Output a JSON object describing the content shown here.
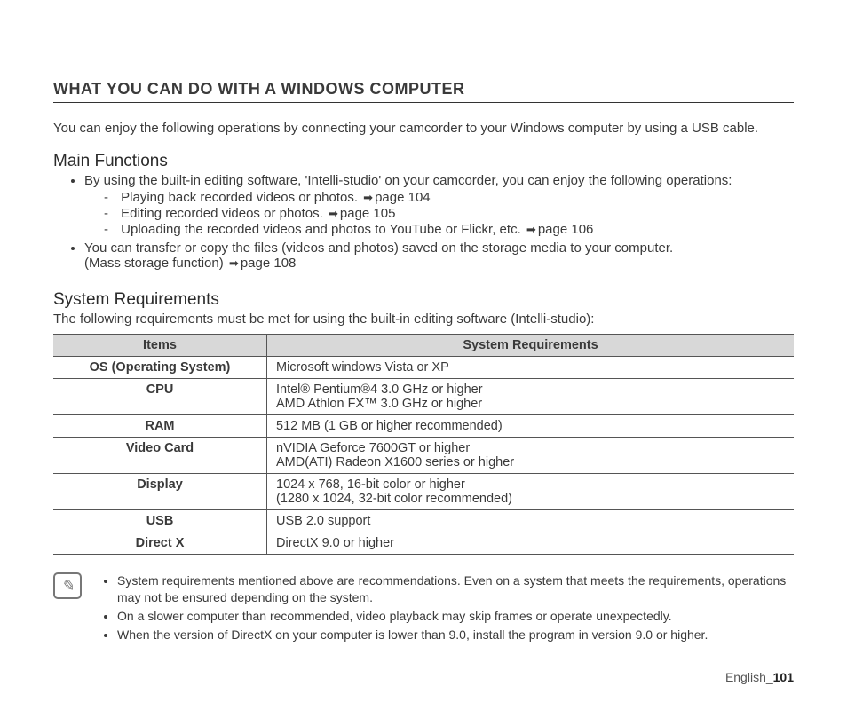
{
  "title": "WHAT YOU CAN DO WITH A WINDOWS COMPUTER",
  "intro": "You can enjoy the following operations by connecting your camcorder to your Windows computer by using a USB cable.",
  "main": {
    "heading": "Main Functions",
    "item1": "By using the built-in editing software, 'Intelli-studio' on your camcorder, you can enjoy the following operations:",
    "sub1_t": "Playing back recorded videos or photos. ",
    "sub1_p": "page 104",
    "sub2_t": "Editing recorded videos or photos. ",
    "sub2_p": "page 105",
    "sub3_t": "Uploading the recorded videos and photos to YouTube or Flickr, etc. ",
    "sub3_p": "page 106",
    "item2_a": "You can transfer or copy the files (videos and photos) saved on the storage media to your computer.",
    "item2_b": "(Mass storage function) ",
    "item2_p": "page 108"
  },
  "sysreq": {
    "heading": "System Requirements",
    "intro": "The following requirements must be met for using the built-in editing software (Intelli-studio):",
    "th1": "Items",
    "th2": "System Requirements",
    "rows": [
      {
        "item": "OS (Operating System)",
        "req": "Microsoft windows Vista or XP"
      },
      {
        "item": "CPU",
        "req": "Intel® Pentium®4 3.0 GHz or higher\nAMD Athlon FX™ 3.0 GHz or higher"
      },
      {
        "item": "RAM",
        "req": "512 MB (1 GB or higher recommended)"
      },
      {
        "item": "Video Card",
        "req": "nVIDIA Geforce 7600GT or higher\nAMD(ATI) Radeon X1600 series or higher"
      },
      {
        "item": "Display",
        "req": "1024 x 768, 16-bit color or higher\n(1280 x 1024, 32-bit color recommended)"
      },
      {
        "item": "USB",
        "req": "USB 2.0 support"
      },
      {
        "item": "Direct X",
        "req": "DirectX 9.0 or higher"
      }
    ]
  },
  "notes": {
    "n1": "System requirements mentioned above are recommendations. Even on a system that meets the requirements, operations may not be ensured depending on the system.",
    "n2": "On a slower computer than recommended, video playback may skip frames or operate unexpectedly.",
    "n3": "When the version of DirectX on your computer is lower than 9.0, install the program in version 9.0 or higher."
  },
  "footer": {
    "lang": "English_",
    "page": "101"
  }
}
